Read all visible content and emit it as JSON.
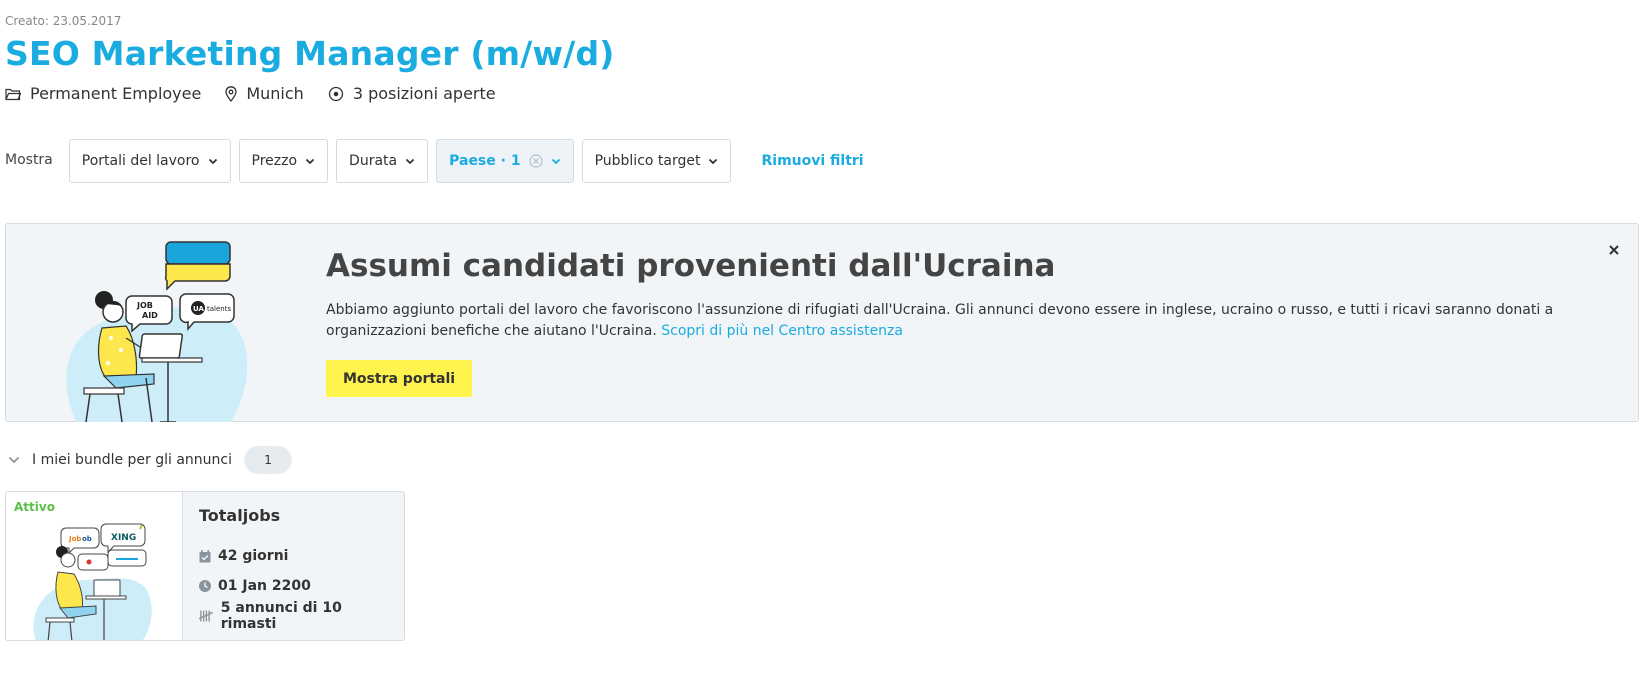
{
  "header": {
    "created": "Creato: 23.05.2017",
    "title": "SEO Marketing Manager (m/w/d)",
    "employment_type": "Permanent Employee",
    "location": "Munich",
    "positions": "3 posizioni aperte"
  },
  "filters": {
    "label": "Mostra",
    "items": [
      {
        "label": "Portali del lavoro",
        "active": false
      },
      {
        "label": "Prezzo",
        "active": false
      },
      {
        "label": "Durata",
        "active": false
      },
      {
        "label": "Paese · 1",
        "active": true
      },
      {
        "label": "Pubblico target",
        "active": false
      }
    ],
    "remove_label": "Rimuovi filtri"
  },
  "banner": {
    "title": "Assumi candidati provenienti dall'Ucraina",
    "text": "Abbiamo aggiunto portali del lavoro che favoriscono l'assunzione di rifugiati dall'Ucraina. Gli annunci devono essere in inglese, ucraino o russo, e tutti i ricavi saranno donati a organizzazioni benefiche che aiutano l'Ucraina.",
    "link": "Scopri di più nel Centro assistenza",
    "button": "Mostra portali",
    "bubble_left": "JOB AID",
    "bubble_right_badge": "UA",
    "bubble_right_text": "talents"
  },
  "bundles": {
    "title": "I miei bundle per gli annunci",
    "count": "1",
    "card": {
      "status": "Attivo",
      "name": "Totaljobs",
      "duration": "42 giorni",
      "expiry": "01 Jan 2200",
      "ads": "5 annunci di 10 rimasti",
      "logo_xing": "XING"
    }
  },
  "colors": {
    "accent": "#1aace0",
    "status_active": "#5cbf4a",
    "cta": "#fff34d",
    "banner_bg": "#f2f5f7",
    "ukraine_blue": "#1aa5dd",
    "ukraine_yellow": "#fde74c"
  },
  "icons": {
    "employment": "folder-icon",
    "location": "map-pin-icon",
    "positions": "target-icon",
    "close": "close-icon",
    "duration": "calendar-icon",
    "expiry": "clock-icon",
    "ads": "tally-icon"
  }
}
